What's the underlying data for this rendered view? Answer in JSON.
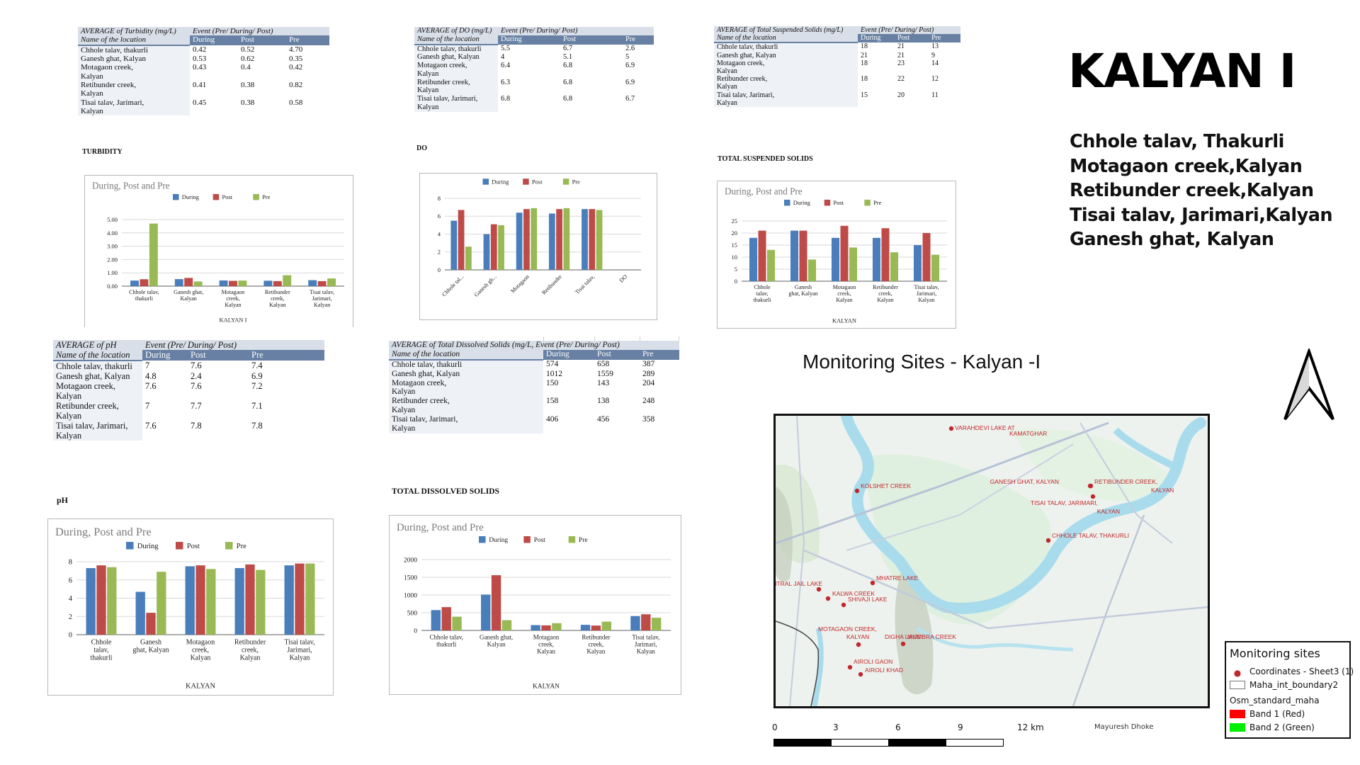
{
  "locations_full": [
    "Chhole talav, thakurli",
    "Ganesh ghat, Kalyan",
    "Motagaon creek, Kalyan",
    "Retibunder creek, Kalyan",
    "Tisai talav, Jarimari, Kalyan"
  ],
  "tables": {
    "turbidity": {
      "measure": "AVERAGE of Turbidity (mg/L)",
      "event_header": "Event (Pre/ During/ Post)",
      "row_header": "Name of the location",
      "columns": [
        "During",
        "Post",
        "Pre"
      ],
      "rows": [
        {
          "loc1": "Chhole talav, thakurli",
          "loc2": "",
          "values": [
            "0.42",
            "0.52",
            "4.70"
          ]
        },
        {
          "loc1": "Ganesh ghat, Kalyan",
          "loc2": "",
          "values": [
            "0.53",
            "0.62",
            "0.35"
          ]
        },
        {
          "loc1": "Motagaon creek,",
          "loc2": "Kalyan",
          "values": [
            "0.43",
            "0.4",
            "0.42"
          ]
        },
        {
          "loc1": "Retibunder creek,",
          "loc2": "Kalyan",
          "values": [
            "0.41",
            "0.38",
            "0.82"
          ]
        },
        {
          "loc1": "Tisai talav, Jarimari,",
          "loc2": "Kalyan",
          "values": [
            "0.45",
            "0.38",
            "0.58"
          ]
        }
      ],
      "label": "TURBIDITY"
    },
    "do": {
      "measure": "AVERAGE of DO (mg/L)",
      "event_header": "Event (Pre/ During/ Post)",
      "row_header": "Name of the location",
      "columns": [
        "During",
        "Post",
        "Pre"
      ],
      "rows": [
        {
          "loc1": "Chhole talav, thakurli",
          "loc2": "",
          "values": [
            "5.5",
            "6.7",
            "2.6"
          ]
        },
        {
          "loc1": "Ganesh ghat, Kalyan",
          "loc2": "",
          "values": [
            "4",
            "5.1",
            "5"
          ]
        },
        {
          "loc1": "Motagaon creek,",
          "loc2": "Kalyan",
          "values": [
            "6.4",
            "6.8",
            "6.9"
          ]
        },
        {
          "loc1": "Retibunder creek,",
          "loc2": "Kalyan",
          "values": [
            "6.3",
            "6.8",
            "6.9"
          ]
        },
        {
          "loc1": "Tisai talav, Jarimari,",
          "loc2": "Kalyan",
          "values": [
            "6.8",
            "6.8",
            "6.7"
          ]
        }
      ],
      "label": "DO"
    },
    "tss": {
      "measure": "AVERAGE of Total Suspended Solids (mg/L)",
      "event_header": "Event (Pre/ During/ Post)",
      "row_header": "Name of the location",
      "columns": [
        "During",
        "Post",
        "Pre"
      ],
      "rows": [
        {
          "loc1": "Chhole talav, thakurli",
          "loc2": "",
          "values": [
            "18",
            "21",
            "13"
          ]
        },
        {
          "loc1": "Ganesh ghat, Kalyan",
          "loc2": "",
          "values": [
            "21",
            "21",
            "9"
          ]
        },
        {
          "loc1": "Motagaon creek,",
          "loc2": "Kalyan",
          "values": [
            "18",
            "23",
            "14"
          ]
        },
        {
          "loc1": "Retibunder creek,",
          "loc2": "Kalyan",
          "values": [
            "18",
            "22",
            "12"
          ]
        },
        {
          "loc1": "Tisai talav, Jarimari,",
          "loc2": "Kalyan",
          "values": [
            "15",
            "20",
            "11"
          ]
        }
      ],
      "label": "TOTAL SUSPENDED SOLIDS"
    },
    "ph": {
      "measure": "AVERAGE of pH",
      "event_header": "Event (Pre/ During/ Post)",
      "row_header": "Name of the location",
      "columns": [
        "During",
        "Post",
        "Pre"
      ],
      "rows": [
        {
          "loc1": "Chhole talav, thakurli",
          "loc2": "",
          "values": [
            "7",
            "7.6",
            "7.4"
          ]
        },
        {
          "loc1": "Ganesh ghat, Kalyan",
          "loc2": "",
          "values": [
            "4.8",
            "2.4",
            "6.9"
          ]
        },
        {
          "loc1": "Motagaon creek,",
          "loc2": "Kalyan",
          "values": [
            "7.6",
            "7.6",
            "7.2"
          ]
        },
        {
          "loc1": "Retibunder creek,",
          "loc2": "Kalyan",
          "values": [
            "7",
            "7.7",
            "7.1"
          ]
        },
        {
          "loc1": "Tisai talav, Jarimari,",
          "loc2": "Kalyan",
          "values": [
            "7.6",
            "7.8",
            "7.8"
          ]
        }
      ],
      "label": "pH"
    },
    "tds": {
      "measure": "AVERAGE of Total Dissolved Solids (mg/L, Event (Pre/ During/ Post)",
      "event_header": "",
      "row_header": "Name of the location",
      "columns": [
        "During",
        "Post",
        "Pre"
      ],
      "rows": [
        {
          "loc1": "Chhole talav, thakurli",
          "loc2": "",
          "values": [
            "574",
            "658",
            "387"
          ]
        },
        {
          "loc1": "Ganesh ghat, Kalyan",
          "loc2": "",
          "values": [
            "1012",
            "1559",
            "289"
          ]
        },
        {
          "loc1": "Motagaon creek,",
          "loc2": "Kalyan",
          "values": [
            "150",
            "143",
            "204"
          ]
        },
        {
          "loc1": "Retibunder creek,",
          "loc2": "Kalyan",
          "values": [
            "158",
            "138",
            "248"
          ]
        },
        {
          "loc1": "Tisai talav, Jarimari,",
          "loc2": "Kalyan",
          "values": [
            "406",
            "456",
            "358"
          ]
        }
      ],
      "label": "TOTAL DISSOLVED SOLIDS"
    }
  },
  "colors": {
    "During": "#4a7ebb",
    "Post": "#be4b48",
    "Pre": "#98b954",
    "table_header": "#6780a3",
    "table_subheader": "#d9dfe8",
    "map_marker": "#c0282d"
  },
  "chart_data": [
    {
      "id": "turbidity",
      "type": "bar",
      "title": "During, Post and Pre",
      "xlabel": "KALYAN I",
      "ylabel": "",
      "categories": [
        [
          "Chhole talav,",
          "thakurli"
        ],
        [
          "Ganesh ghat,",
          "Kalyan"
        ],
        [
          "Motagaon",
          "creek,",
          "Kalyan"
        ],
        [
          "Retibunder",
          "creek,",
          "Kalyan"
        ],
        [
          "Tisai talav,",
          "Jarimari,",
          "Kalyan"
        ]
      ],
      "series": [
        {
          "name": "During",
          "values": [
            0.42,
            0.53,
            0.43,
            0.41,
            0.45
          ]
        },
        {
          "name": "Post",
          "values": [
            0.52,
            0.62,
            0.4,
            0.38,
            0.38
          ]
        },
        {
          "name": "Pre",
          "values": [
            4.7,
            0.35,
            0.42,
            0.82,
            0.58
          ]
        }
      ],
      "ylim": [
        0,
        5
      ],
      "yticks": [
        "0.00",
        "1.00",
        "2.00",
        "3.00",
        "4.00",
        "5.00"
      ],
      "grid": true,
      "legend": "top-center"
    },
    {
      "id": "do",
      "type": "bar",
      "title": "",
      "xlabel": "",
      "ylabel": "",
      "categories": [
        [
          "Chhole tal..."
        ],
        [
          "Ganesh gh..."
        ],
        [
          "Motagaon"
        ],
        [
          "Retibunder"
        ],
        [
          "Tisai talav,"
        ],
        [
          "DO"
        ]
      ],
      "series": [
        {
          "name": "During",
          "values": [
            5.5,
            4,
            6.4,
            6.3,
            6.8,
            null
          ]
        },
        {
          "name": "Post",
          "values": [
            6.7,
            5.1,
            6.8,
            6.8,
            6.8,
            null
          ]
        },
        {
          "name": "Pre",
          "values": [
            2.6,
            5,
            6.9,
            6.9,
            6.7,
            null
          ]
        }
      ],
      "ylim": [
        0,
        8
      ],
      "yticks": [
        "0",
        "2",
        "4",
        "6",
        "8"
      ],
      "grid": true,
      "legend": "top-center",
      "rotated_labels": true
    },
    {
      "id": "tss",
      "type": "bar",
      "title": "During, Post and Pre",
      "xlabel": "KALYAN",
      "ylabel": "",
      "categories": [
        [
          "Chhole",
          "talav,",
          "thakurli"
        ],
        [
          "Ganesh",
          "ghat, Kalyan"
        ],
        [
          "Motagaon",
          "creek,",
          "Kalyan"
        ],
        [
          "Retibunder",
          "creek,",
          "Kalyan"
        ],
        [
          "Tisai talav,",
          "Jarimari,",
          "Kalyan"
        ]
      ],
      "series": [
        {
          "name": "During",
          "values": [
            18,
            21,
            18,
            18,
            15
          ]
        },
        {
          "name": "Post",
          "values": [
            21,
            21,
            23,
            22,
            20
          ]
        },
        {
          "name": "Pre",
          "values": [
            13,
            9,
            14,
            12,
            11
          ]
        }
      ],
      "ylim": [
        0,
        25
      ],
      "yticks": [
        "0",
        "5",
        "10",
        "15",
        "20",
        "25"
      ],
      "grid": true,
      "legend": "top-center"
    },
    {
      "id": "ph",
      "type": "bar",
      "title": "During, Post and Pre",
      "xlabel": "KALYAN",
      "ylabel": "",
      "categories": [
        [
          "Chhole",
          "talav,",
          "thakurli"
        ],
        [
          "Ganesh",
          "ghat, Kalyan"
        ],
        [
          "Motagaon",
          "creek,",
          "Kalyan"
        ],
        [
          "Retibunder",
          "creek,",
          "Kalyan"
        ],
        [
          "Tisai talav,",
          "Jarimari,",
          "Kalyan"
        ]
      ],
      "series": [
        {
          "name": "During",
          "values": [
            7.3,
            4.7,
            7.5,
            7.3,
            7.6
          ]
        },
        {
          "name": "Post",
          "values": [
            7.6,
            2.4,
            7.6,
            7.7,
            7.8
          ]
        },
        {
          "name": "Pre",
          "values": [
            7.4,
            6.9,
            7.2,
            7.1,
            7.8
          ]
        }
      ],
      "ylim": [
        0,
        8
      ],
      "yticks": [
        "0",
        "2",
        "4",
        "6",
        "8"
      ],
      "grid": true,
      "legend": "top-center"
    },
    {
      "id": "tds",
      "type": "bar",
      "title": "During, Post and Pre",
      "xlabel": "KALYAN",
      "ylabel": "",
      "categories": [
        [
          "Chhole talav,",
          "thakurli"
        ],
        [
          "Ganesh ghat,",
          "Kalyan"
        ],
        [
          "Motagaon",
          "creek,",
          "Kalyan"
        ],
        [
          "Retibunder",
          "creek,",
          "Kalyan"
        ],
        [
          "Tisai talav,",
          "Jarimari,",
          "Kalyan"
        ]
      ],
      "series": [
        {
          "name": "During",
          "values": [
            574,
            1012,
            150,
            158,
            406
          ]
        },
        {
          "name": "Post",
          "values": [
            658,
            1559,
            143,
            138,
            456
          ]
        },
        {
          "name": "Pre",
          "values": [
            387,
            289,
            204,
            248,
            358
          ]
        }
      ],
      "ylim": [
        0,
        2000
      ],
      "yticks": [
        "0",
        "500",
        "1000",
        "1500",
        "2000"
      ],
      "grid": true,
      "legend": "top-center"
    }
  ],
  "panel": {
    "title": "KALYAN I",
    "sites": [
      "Chhole talav, Thakurli",
      "Motagaon creek,Kalyan",
      "Retibunder creek,Kalyan",
      "Tisai talav, Jarimari,Kalyan",
      "Ganesh ghat, Kalyan"
    ]
  },
  "map": {
    "title": "Monitoring Sites - Kalyan -I",
    "sites": [
      {
        "label": "VARAHDEVI LAKE AT",
        "label2": "KAMATGHAR"
      },
      {
        "label": "KOLSHET CREEK",
        "label2": ""
      },
      {
        "label": "GANESH GHAT, KALYAN",
        "label2": ""
      },
      {
        "label": "RETIBUNDER CREEK,",
        "label2": "KALYAN"
      },
      {
        "label": "TISAI TALAV, JARIMARI,",
        "label2": "KALYAN"
      },
      {
        "label": "CHHOLE TALAV, THAKURLI",
        "label2": ""
      },
      {
        "label": "MHATRE LAKE",
        "label2": ""
      },
      {
        "label": "CENTRAL JAIL LAKE",
        "label2": ""
      },
      {
        "label": "KALWA CREEK",
        "label2": ""
      },
      {
        "label": "SHIVAJI LAKE",
        "label2": ""
      },
      {
        "label": "MOTAGAON CREEK,",
        "label2": "KALYAN"
      },
      {
        "label": "DIGHA LAKE",
        "label2": ""
      },
      {
        "label": "MUMBRA CREEK",
        "label2": ""
      },
      {
        "label": "AIROLI GAON",
        "label2": ""
      },
      {
        "label": "AIROLI KHAD",
        "label2": ""
      }
    ],
    "legend": {
      "title": "Monitoring sites",
      "items": [
        "Coordinates - Sheet3 (1)",
        "Maha_int_boundary2",
        "Osm_standard_maha",
        "Band 1 (Red)",
        "Band 2 (Green)"
      ]
    },
    "scale": {
      "ticks": [
        "0",
        "3",
        "6",
        "9",
        "12 km"
      ]
    },
    "author": "Mayuresh Dhoke"
  }
}
